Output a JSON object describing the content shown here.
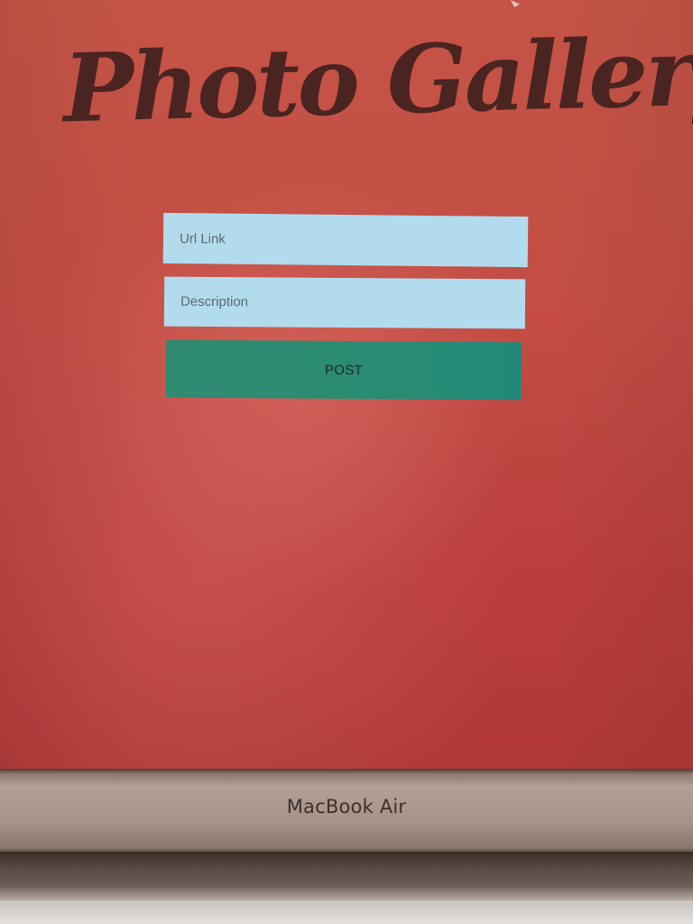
{
  "app": {
    "title": "Photo Gallery"
  },
  "form": {
    "url_placeholder": "Url Link",
    "url_value": "",
    "description_placeholder": "Description",
    "description_value": "",
    "post_label": "POST"
  },
  "device": {
    "label": "MacBook Air"
  },
  "colors": {
    "background": "#c44d45",
    "title": "#4a2420",
    "input_background": "#b2dcee",
    "button_background": "#2a8c72"
  }
}
